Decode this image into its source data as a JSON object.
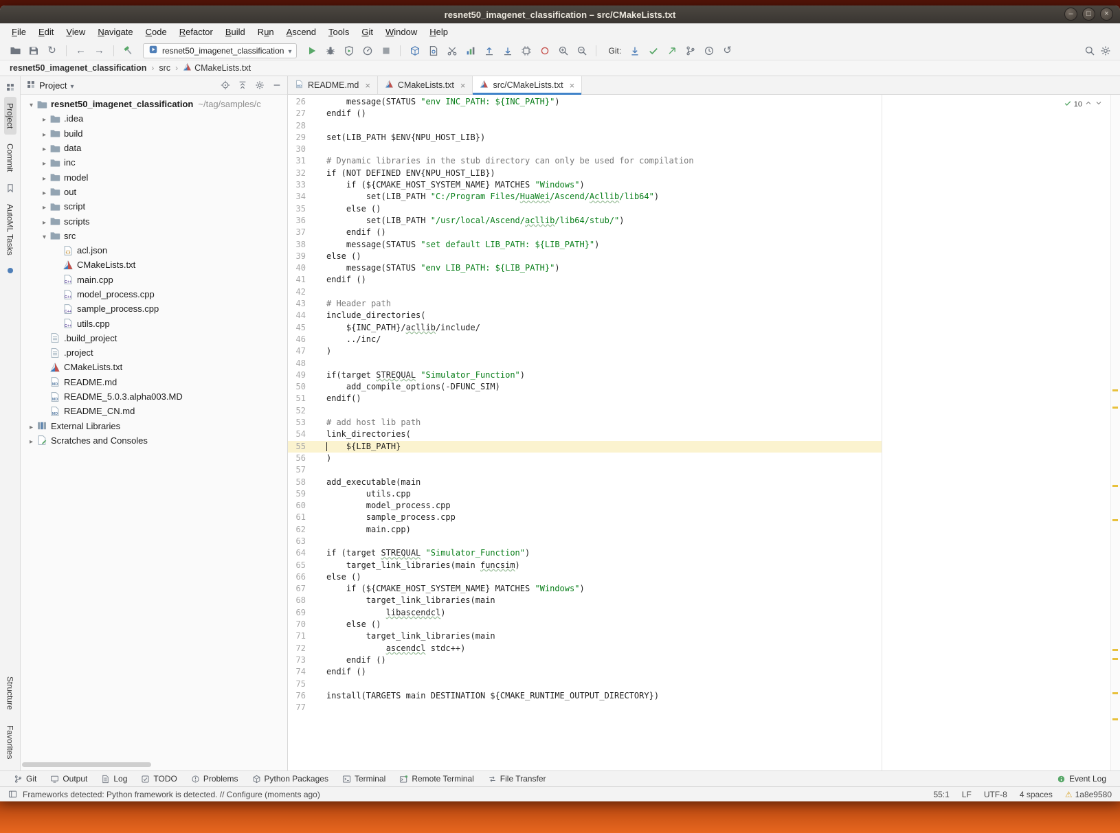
{
  "colors": {
    "ubuntu_orange": "#E2621B",
    "titlebar": "#3E3A36",
    "accent_blue": "#4083C9",
    "run_green": "#59A869",
    "caret_line_bg": "#FBF3CF",
    "string_green": "#067D17",
    "comment_gray": "#787878",
    "warning_yellow": "#E8C13B"
  },
  "title_bar": {
    "title": "resnet50_imagenet_classification – src/CMakeLists.txt",
    "buttons": [
      {
        "name": "minimize-button",
        "glyph": "–"
      },
      {
        "name": "maximize-button",
        "glyph": "□"
      },
      {
        "name": "close-button",
        "glyph": "×"
      }
    ]
  },
  "menu": {
    "items": [
      {
        "label": "File",
        "m": 0
      },
      {
        "label": "Edit",
        "m": 0
      },
      {
        "label": "View",
        "m": 0
      },
      {
        "label": "Navigate",
        "m": 0
      },
      {
        "label": "Code",
        "m": 0
      },
      {
        "label": "Refactor",
        "m": 0
      },
      {
        "label": "Build",
        "m": 0
      },
      {
        "label": "Run",
        "m": 1
      },
      {
        "label": "Ascend",
        "m": 0
      },
      {
        "label": "Tools",
        "m": 0
      },
      {
        "label": "Git",
        "m": 0
      },
      {
        "label": "Window",
        "m": 0
      },
      {
        "label": "Help",
        "m": 0
      }
    ]
  },
  "toolbar": {
    "run_config": "resnet50_imagenet_classification",
    "items": [
      {
        "t": "icon",
        "name": "open-icon",
        "g": "folder-open"
      },
      {
        "t": "icon",
        "name": "save-all-icon",
        "g": "save"
      },
      {
        "t": "icon",
        "name": "sync-icon",
        "g": "sync"
      },
      {
        "t": "sep"
      },
      {
        "t": "icon",
        "name": "back-icon",
        "g": "arrow-left"
      },
      {
        "t": "icon",
        "name": "forward-icon",
        "g": "arrow-right"
      },
      {
        "t": "sep"
      },
      {
        "t": "icon",
        "name": "build-hammer-icon",
        "g": "hammer"
      },
      {
        "t": "combo"
      },
      {
        "t": "icon",
        "name": "run-icon",
        "g": "play"
      },
      {
        "t": "icon",
        "name": "debug-icon",
        "g": "bug"
      },
      {
        "t": "icon",
        "name": "coverage-shield-icon",
        "g": "shield"
      },
      {
        "t": "icon",
        "name": "profiler-gauge-icon",
        "g": "gauge"
      },
      {
        "t": "icon",
        "name": "stop-icon",
        "g": "stop"
      },
      {
        "t": "sep"
      },
      {
        "t": "icon",
        "name": "cube-icon",
        "g": "cube"
      },
      {
        "t": "icon",
        "name": "doc-gear-icon",
        "g": "docgear"
      },
      {
        "t": "icon",
        "name": "scissors-icon",
        "g": "scissors"
      },
      {
        "t": "icon",
        "name": "chart-icon",
        "g": "chart"
      },
      {
        "t": "icon",
        "name": "upload-icon",
        "g": "upload"
      },
      {
        "t": "icon",
        "name": "download-icon",
        "g": "download"
      },
      {
        "t": "icon",
        "name": "chip-icon",
        "g": "chip"
      },
      {
        "t": "icon",
        "name": "record-icon",
        "g": "record"
      },
      {
        "t": "icon",
        "name": "zoom-in-icon",
        "g": "zoomin"
      },
      {
        "t": "icon",
        "name": "zoom-out-icon",
        "g": "zoomout"
      },
      {
        "t": "sep"
      },
      {
        "t": "label",
        "name": "git-label",
        "label": "Git:"
      },
      {
        "t": "icon",
        "name": "git-update-icon",
        "g": "git-down"
      },
      {
        "t": "icon",
        "name": "git-commit-check-icon",
        "g": "check"
      },
      {
        "t": "icon",
        "name": "git-push-icon",
        "g": "git-up"
      },
      {
        "t": "icon",
        "name": "git-branch-icon",
        "g": "branch"
      },
      {
        "t": "icon",
        "name": "git-history-clock-icon",
        "g": "clock"
      },
      {
        "t": "icon",
        "name": "git-rollback-icon",
        "g": "undo"
      }
    ],
    "right_items": [
      {
        "t": "icon",
        "name": "search-icon",
        "g": "magnifier"
      },
      {
        "t": "icon",
        "name": "settings-gear-icon",
        "g": "gear"
      }
    ]
  },
  "breadcrumbs": {
    "separator": "›",
    "items": [
      {
        "label": "resnet50_imagenet_classification",
        "bold": true,
        "name": "breadcrumb-project"
      },
      {
        "label": "src",
        "name": "breadcrumb-src"
      },
      {
        "label": "CMakeLists.txt",
        "icon": "cmake",
        "name": "breadcr umb-file"
      }
    ]
  },
  "left_stripe": {
    "top": [
      {
        "t": "icon",
        "name": "toolwindow-grid-icon",
        "g": "grid"
      },
      {
        "t": "label",
        "label": "Project",
        "name": "project-stripe-button",
        "active": true
      },
      {
        "t": "label",
        "label": "Commit",
        "name": "commit-stripe-button"
      },
      {
        "t": "icon",
        "name": "bookmark-icon",
        "g": "bookmark"
      },
      {
        "t": "label",
        "label": "AutoML Tasks",
        "name": "automl-tasks-stripe-button"
      },
      {
        "t": "icon",
        "name": "blue-dot-icon",
        "g": "bluedot"
      }
    ],
    "bottom": [
      {
        "t": "label",
        "label": "Structure",
        "name": "structure-stripe-button"
      },
      {
        "t": "label",
        "label": "Favorites",
        "name": "favorites-stripe-button"
      }
    ]
  },
  "project_panel": {
    "header": "Project",
    "header_icons": [
      {
        "name": "locate-file-icon",
        "g": "target"
      },
      {
        "name": "collapse-all-icon",
        "g": "collapse-all"
      },
      {
        "name": "settings-gear-icon",
        "g": "gear"
      },
      {
        "name": "hide-panel-icon",
        "g": "minus"
      }
    ],
    "tree": [
      {
        "label": "resnet50_imagenet_classification",
        "suffix": "~/tag/samples/c",
        "icon": "folder",
        "depth": 0,
        "chev": "down",
        "bold": true
      },
      {
        "label": ".idea",
        "icon": "folder",
        "depth": 1,
        "chev": "right"
      },
      {
        "label": "build",
        "icon": "folder",
        "depth": 1,
        "chev": "right"
      },
      {
        "label": "data",
        "icon": "folder",
        "depth": 1,
        "chev": "right"
      },
      {
        "label": "inc",
        "icon": "folder",
        "depth": 1,
        "chev": "right"
      },
      {
        "label": "model",
        "icon": "folder",
        "depth": 1,
        "chev": "right"
      },
      {
        "label": "out",
        "icon": "folder",
        "depth": 1,
        "chev": "right"
      },
      {
        "label": "script",
        "icon": "folder",
        "depth": 1,
        "chev": "right"
      },
      {
        "label": "scripts",
        "icon": "folder",
        "depth": 1,
        "chev": "right"
      },
      {
        "label": "src",
        "icon": "folder",
        "depth": 1,
        "chev": "down"
      },
      {
        "label": "acl.json",
        "icon": "json",
        "depth": 2
      },
      {
        "label": "CMakeLists.txt",
        "icon": "cmake",
        "depth": 2
      },
      {
        "label": "main.cpp",
        "icon": "cpp",
        "depth": 2
      },
      {
        "label": "model_process.cpp",
        "icon": "cpp",
        "depth": 2
      },
      {
        "label": "sample_process.cpp",
        "icon": "cpp",
        "depth": 2
      },
      {
        "label": "utils.cpp",
        "icon": "cpp",
        "depth": 2
      },
      {
        "label": ".build_project",
        "icon": "txt",
        "depth": 1
      },
      {
        "label": ".project",
        "icon": "txt",
        "depth": 1
      },
      {
        "label": "CMakeLists.txt",
        "icon": "cmake",
        "depth": 1
      },
      {
        "label": "README.md",
        "icon": "md",
        "depth": 1
      },
      {
        "label": "README_5.0.3.alpha003.MD",
        "icon": "md",
        "depth": 1
      },
      {
        "label": "README_CN.md",
        "icon": "md",
        "depth": 1
      },
      {
        "label": "External Libraries",
        "icon": "lib",
        "depth": 0,
        "chev": "right"
      },
      {
        "label": "Scratches and Consoles",
        "icon": "scratch",
        "depth": 0,
        "chev": "right"
      }
    ]
  },
  "tabs": [
    {
      "label": "README.md",
      "icon": "md"
    },
    {
      "label": "CMakeLists.txt",
      "icon": "cmake"
    },
    {
      "label": "src/CMakeLists.txt",
      "icon": "cmake",
      "active": true
    }
  ],
  "editor": {
    "first_line": 26,
    "caret_line": 55,
    "inspection": {
      "count": "10"
    },
    "typo_words": [
      "acllib",
      "Acllib",
      "HuaWei",
      "funcsim",
      "libascendcl",
      "ascendcl",
      "STREQUAL"
    ],
    "stripe_marks": [
      34,
      36,
      45,
      49,
      64,
      65,
      69,
      72
    ],
    "lines": [
      "    message(STATUS \"env INC_PATH: ${INC_PATH}\")",
      "endif ()",
      "",
      "set(LIB_PATH $ENV{NPU_HOST_LIB})",
      "",
      "# Dynamic libraries in the stub directory can only be used for compilation",
      "if (NOT DEFINED ENV{NPU_HOST_LIB})",
      "    if (${CMAKE_HOST_SYSTEM_NAME} MATCHES \"Windows\")",
      "        set(LIB_PATH \"C:/Program Files/HuaWei/Ascend/Acllib/lib64\")",
      "    else ()",
      "        set(LIB_PATH \"/usr/local/Ascend/acllib/lib64/stub/\")",
      "    endif ()",
      "    message(STATUS \"set default LIB_PATH: ${LIB_PATH}\")",
      "else ()",
      "    message(STATUS \"env LIB_PATH: ${LIB_PATH}\")",
      "endif ()",
      "",
      "# Header path",
      "include_directories(",
      "    ${INC_PATH}/acllib/include/",
      "    ../inc/",
      ")",
      "",
      "if(target STREQUAL \"Simulator_Function\")",
      "    add_compile_options(-DFUNC_SIM)",
      "endif()",
      "",
      "# add host lib path",
      "link_directories(",
      "    ${LIB_PATH}",
      ")",
      "",
      "add_executable(main",
      "        utils.cpp",
      "        model_process.cpp",
      "        sample_process.cpp",
      "        main.cpp)",
      "",
      "if (target STREQUAL \"Simulator_Function\")",
      "    target_link_libraries(main funcsim)",
      "else ()",
      "    if (${CMAKE_HOST_SYSTEM_NAME} MATCHES \"Windows\")",
      "        target_link_libraries(main",
      "            libascendcl)",
      "    else ()",
      "        target_link_libraries(main",
      "            ascendcl stdc++)",
      "    endif ()",
      "endif ()",
      "",
      "install(TARGETS main DESTINATION ${CMAKE_RUNTIME_OUTPUT_DIRECTORY})",
      ""
    ]
  },
  "bottom_bar": {
    "left": [
      {
        "label": "Git",
        "icon": "branch",
        "name": "git-toolwindow-button"
      },
      {
        "label": "Output",
        "icon": "monitor",
        "name": "output-toolwindow-button"
      },
      {
        "label": "Log",
        "icon": "doclines",
        "name": "log-toolwindow-button"
      },
      {
        "label": "TODO",
        "icon": "todo",
        "name": "todo-toolwindow-button"
      },
      {
        "label": "Problems",
        "icon": "problems",
        "name": "problems-toolwindow-button"
      },
      {
        "label": "Python Packages",
        "icon": "pypkg",
        "name": "python-packages-toolwindow-button"
      },
      {
        "label": "Terminal",
        "icon": "terminal",
        "name": "terminal-toolwindow-button"
      },
      {
        "label": "Remote Terminal",
        "icon": "remote-terminal",
        "name": "remote-terminal-toolwindow-button"
      },
      {
        "label": "File Transfer",
        "icon": "transfer",
        "name": "file-transfer-toolwindow-button"
      }
    ],
    "right": [
      {
        "label": "Event Log",
        "icon": "event",
        "name": "event-log-button"
      }
    ]
  },
  "status_bar": {
    "message": "Frameworks detected: Python framework is detected. // Configure (moments ago)",
    "right": [
      {
        "name": "caret-position",
        "label": "55:1"
      },
      {
        "name": "line-separator",
        "label": "LF"
      },
      {
        "name": "file-encoding",
        "label": "UTF-8"
      },
      {
        "name": "indent-style",
        "label": "4 spaces"
      },
      {
        "name": "git-revision",
        "label": "1a8e9580",
        "icon": "warn"
      }
    ]
  }
}
